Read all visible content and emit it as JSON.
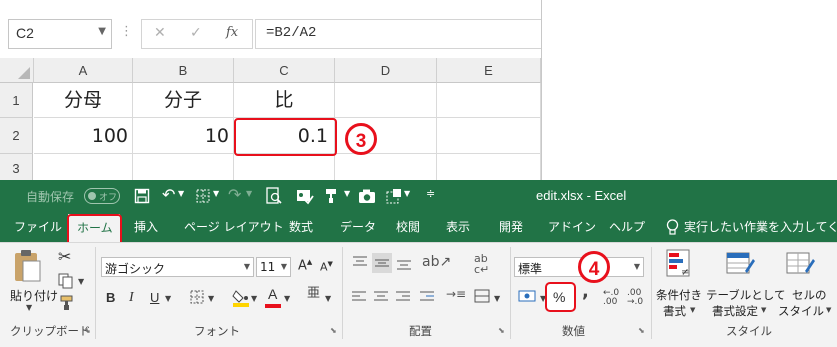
{
  "formula_bar": {
    "name_box": "C2",
    "formula": "=B2/A2",
    "fx_label": "fx"
  },
  "grid": {
    "columns": [
      "A",
      "B",
      "C",
      "D",
      "E"
    ],
    "rows": [
      {
        "num": "1",
        "cells": [
          "分母",
          "分子",
          "比",
          "",
          ""
        ]
      },
      {
        "num": "2",
        "cells": [
          "100",
          "10",
          "0.1",
          "",
          ""
        ]
      },
      {
        "num": "3",
        "cells": [
          "",
          "",
          "",
          "",
          ""
        ]
      }
    ]
  },
  "callouts": {
    "step3": "3",
    "step4": "4"
  },
  "title_bar": {
    "autosave_label": "自動保存",
    "autosave_state": "オフ",
    "file_title": "edit.xlsx  -  Excel"
  },
  "tabs": [
    "ファイル",
    "ホーム",
    "挿入",
    "ページ レイアウト",
    "数式",
    "データ",
    "校閲",
    "表示",
    "開発",
    "アドイン",
    "ヘルプ"
  ],
  "active_tab": "ホーム",
  "tell_me": "実行したい作業を入力してくだ",
  "ribbon": {
    "clipboard": {
      "paste_label": "貼り付け",
      "group_label": "クリップボード"
    },
    "font": {
      "font_name": "游ゴシック",
      "font_size": "11",
      "group_label": "フォント",
      "bold": "B",
      "italic": "I",
      "underline": "U"
    },
    "alignment": {
      "group_label": "配置"
    },
    "number": {
      "format": "標準",
      "percent": "%",
      "comma": ",",
      "group_label": "数値"
    },
    "styles": {
      "cond_format": [
        "条件付き",
        "書式"
      ],
      "table_format": [
        "テーブルとして",
        "書式設定"
      ],
      "cell_style": [
        "セルの",
        "スタイル"
      ],
      "group_label": "スタイル"
    }
  },
  "colors": {
    "excel_green": "#217346",
    "callout_red": "#e8101c",
    "font_color": "#e8101c",
    "highlight": "#ffd400"
  }
}
